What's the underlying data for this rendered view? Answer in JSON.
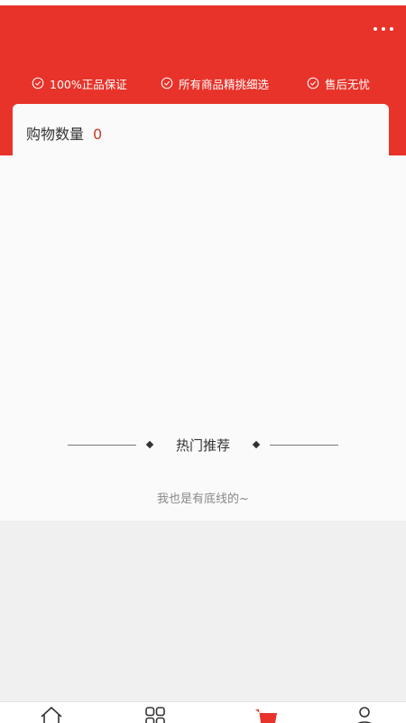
{
  "header": {
    "guarantees": [
      {
        "label": "100%正品保证",
        "icon": "check-circle-icon"
      },
      {
        "label": "所有商品精挑细选",
        "icon": "check-circle-icon"
      },
      {
        "label": "售后无忧",
        "icon": "check-circle-icon"
      }
    ],
    "more_icon": "more-dots-icon"
  },
  "cart": {
    "count_label": "购物数量",
    "count_value": "0"
  },
  "recommend": {
    "title": "热门推荐",
    "end_text": "我也是有底线的~"
  },
  "tabbar": {
    "items": [
      {
        "icon": "home-icon"
      },
      {
        "icon": "category-icon"
      },
      {
        "icon": "cart-icon",
        "active": true
      },
      {
        "icon": "user-icon"
      }
    ]
  },
  "colors": {
    "brand": "#e8332a",
    "count": "#c8392b",
    "background": "#fafafa"
  }
}
